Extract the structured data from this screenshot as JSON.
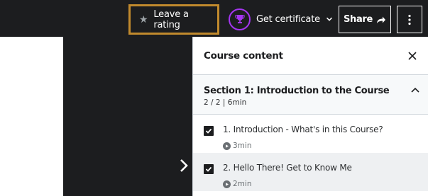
{
  "topbar": {
    "rating_label": "Leave a rating",
    "certificate_label": "Get certificate",
    "share_label": "Share"
  },
  "sidebar": {
    "title": "Course content",
    "section": {
      "title": "Section 1: Introduction to the Course",
      "meta": "2 / 2 | 6min"
    },
    "lectures": [
      {
        "title": "1. Introduction - What's in this Course?",
        "duration": "3min",
        "completed": true
      },
      {
        "title": "2. Hello There! Get to Know Me",
        "duration": "2min",
        "completed": true
      }
    ]
  },
  "colors": {
    "accent": "#a435f0",
    "highlight_border": "#c18a2d",
    "dark_bg": "#1c1d1f"
  }
}
